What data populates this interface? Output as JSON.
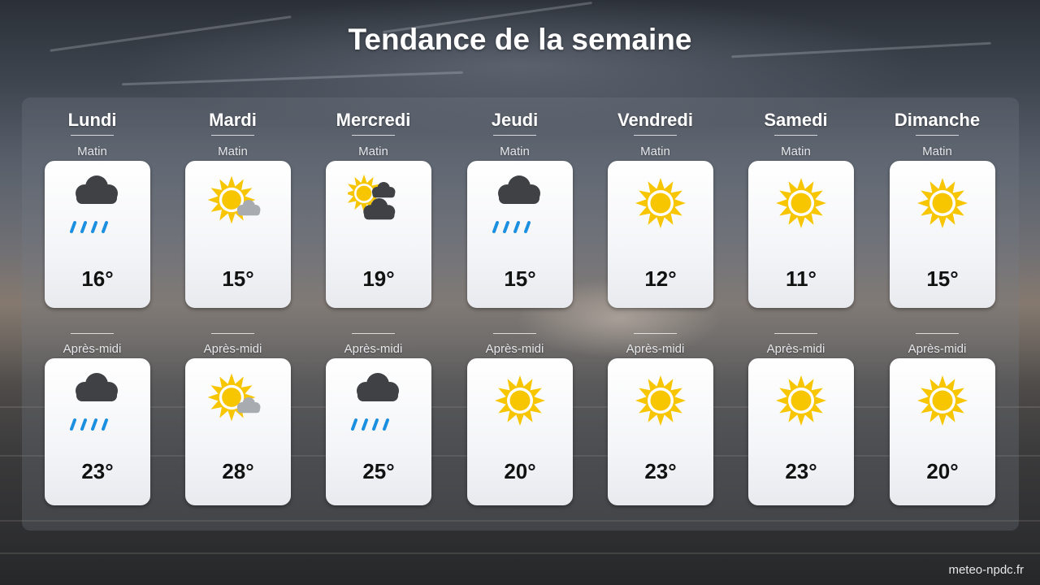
{
  "title": "Tendance de la semaine",
  "footer": "meteo-npdc.fr",
  "colors": {
    "sun": "#f7c600",
    "cloud_dark": "#3f4145",
    "cloud_light": "#a8abb0",
    "rain": "#1b8fe0"
  },
  "days": [
    {
      "name": "Lundi",
      "morning": {
        "label": "Matin",
        "icon": "rain-icon",
        "temp": "16°"
      },
      "afternoon": {
        "label": "Après-midi",
        "icon": "rain-icon",
        "temp": "23°"
      }
    },
    {
      "name": "Mardi",
      "morning": {
        "label": "Matin",
        "icon": "sun-cloud-icon",
        "temp": "15°"
      },
      "afternoon": {
        "label": "Après-midi",
        "icon": "sun-cloud-icon",
        "temp": "28°"
      }
    },
    {
      "name": "Mercredi",
      "morning": {
        "label": "Matin",
        "icon": "mostly-cloudy-icon",
        "temp": "19°"
      },
      "afternoon": {
        "label": "Après-midi",
        "icon": "rain-icon",
        "temp": "25°"
      }
    },
    {
      "name": "Jeudi",
      "morning": {
        "label": "Matin",
        "icon": "rain-icon",
        "temp": "15°"
      },
      "afternoon": {
        "label": "Après-midi",
        "icon": "sun-icon",
        "temp": "20°"
      }
    },
    {
      "name": "Vendredi",
      "morning": {
        "label": "Matin",
        "icon": "sun-icon",
        "temp": "12°"
      },
      "afternoon": {
        "label": "Après-midi",
        "icon": "sun-icon",
        "temp": "23°"
      }
    },
    {
      "name": "Samedi",
      "morning": {
        "label": "Matin",
        "icon": "sun-icon",
        "temp": "11°"
      },
      "afternoon": {
        "label": "Après-midi",
        "icon": "sun-icon",
        "temp": "23°"
      }
    },
    {
      "name": "Dimanche",
      "morning": {
        "label": "Matin",
        "icon": "sun-icon",
        "temp": "15°"
      },
      "afternoon": {
        "label": "Après-midi",
        "icon": "sun-icon",
        "temp": "20°"
      }
    }
  ]
}
